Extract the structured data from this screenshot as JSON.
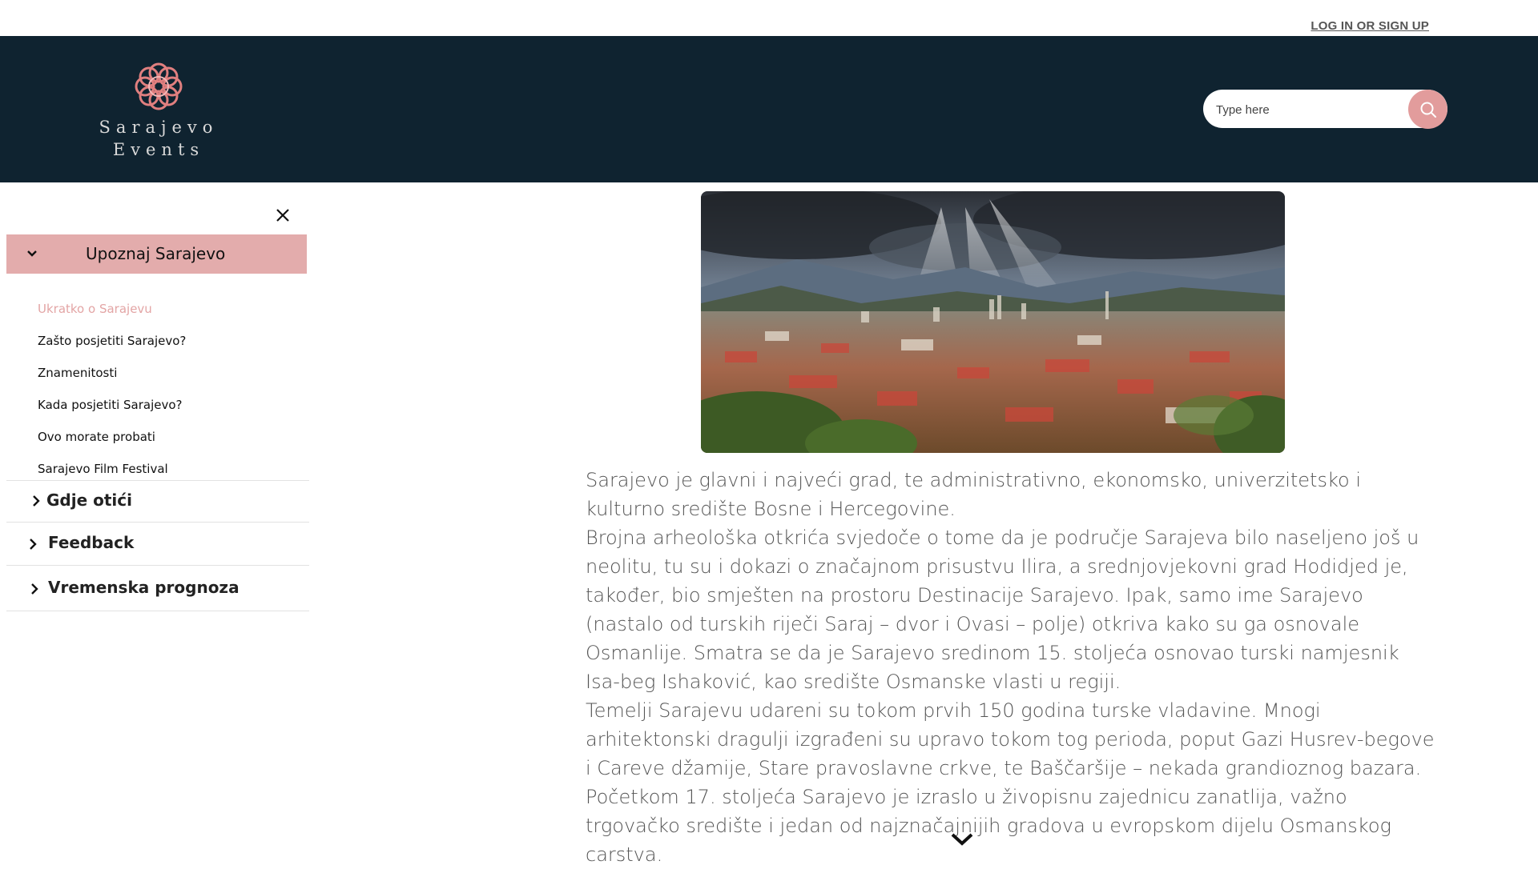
{
  "topbar": {
    "login_label": "LOG IN OR SIGN UP"
  },
  "brand": {
    "line1": "Sarajevo",
    "line2": "Events",
    "logo_icon": "knot-rosette-icon",
    "accent_color": "#e29c9c",
    "header_bg": "#0f2330"
  },
  "search": {
    "placeholder": "Type here",
    "icon": "search-icon"
  },
  "sidebar": {
    "open_section": {
      "label": "Upoznaj Sarajevo",
      "items": [
        {
          "label": "Ukratko o Sarajevu",
          "active": true
        },
        {
          "label": "Zašto posjetiti Sarajevo?"
        },
        {
          "label": "Znamenitosti"
        },
        {
          "label": "Kada posjetiti Sarajevo?"
        },
        {
          "label": "Ovo morate probati"
        },
        {
          "label": "Sarajevo Film Festival"
        }
      ]
    },
    "sections": [
      {
        "label": "Gdje otići"
      },
      {
        "label": "Feedback"
      },
      {
        "label": "Vremenska prognoza"
      }
    ]
  },
  "main": {
    "hero_image": "sarajevo-panorama-image",
    "paragraphs": [
      "Sarajevo je glavni i najveći grad, te administrativno, ekonomsko, univerzitetsko i kulturno središte Bosne i Hercegovine.",
      "Brojna arheološka otkrića svjedoče o tome da je područje Sarajeva bilo naseljeno još u neolitu, tu su i dokazi o značajnom prisustvu Ilira, a srednjovjekovni grad Hodidjed je, također, bio smješten na prostoru Destinacije Sarajevo. Ipak, samo ime Sarajevo (nastalo od turskih riječi Saraj – dvor i Ovasi – polje) otkriva kako su ga osnovale Osmanlije. Smatra se da je Sarajevo sredinom 15. stoljeća osnovao turski namjesnik Isa-beg Ishaković, kao središte Osmanske vlasti u regiji.",
      "Temelji Sarajevu udareni su tokom prvih 150 godina turske vladavine. Mnogi arhitektonski dragulji izgrađeni su upravo tokom tog perioda, poput Gazi Husrev-begove i Careve džamije, Stare pravoslavne crkve, te Baščaršije – nekada grandioznog bazara. Početkom 17. stoljeća Sarajevo je izraslo u živopisnu zajednicu zanatlija, važno trgovačko središte i jedan od najznačajnijih gradova u evropskom dijelu Osmanskog carstva."
    ]
  }
}
